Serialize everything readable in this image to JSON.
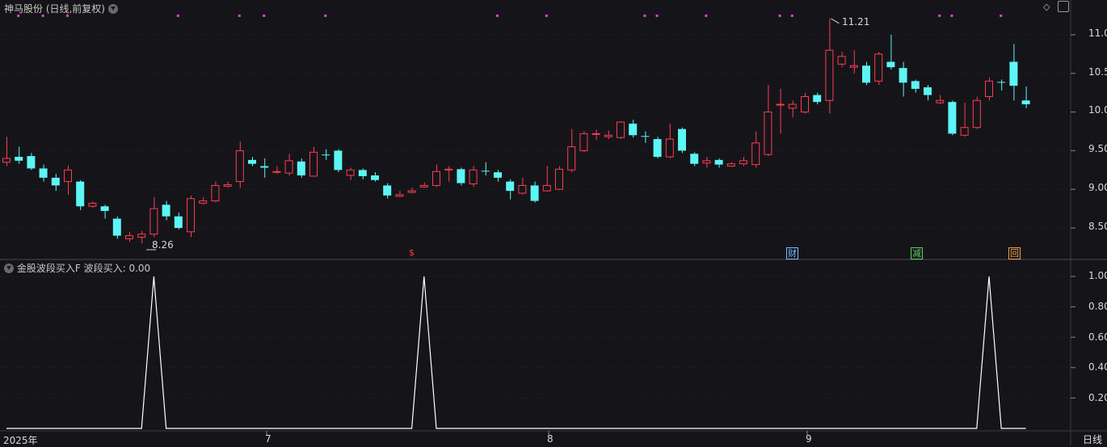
{
  "header": {
    "title": "神马股份 (日线,前复权)"
  },
  "indicator": {
    "name": "金股波段买入F",
    "value_label": "波段买入:",
    "value": "0.00"
  },
  "toolbar": {
    "diamond_icon": "diamond-icon",
    "window_icon": "window-toggle-icon"
  },
  "period_label": "日线",
  "x_axis": {
    "labels": [
      "2025年",
      "7",
      "8",
      "9"
    ]
  },
  "price_axis": [
    "11.00",
    "10.50",
    "10.00",
    "9.50",
    "9.00",
    "8.50"
  ],
  "indicator_axis": [
    "1.00",
    "0.80",
    "0.60",
    "0.40",
    "0.20"
  ],
  "annotations": {
    "high": "11.21",
    "low": "8.26"
  },
  "events": [
    {
      "text": "$",
      "color": "#ff3b3b"
    },
    {
      "text": "财",
      "color": "#7ab8ff"
    },
    {
      "text": "减",
      "color": "#5fd35f"
    },
    {
      "text": "回",
      "color": "#f0a050"
    }
  ],
  "colors": {
    "up": "#ff3b52",
    "down": "#5df5f5",
    "dot": "#e040e0",
    "line": "#ffffff"
  },
  "chart_data": {
    "type": "candlestick",
    "price_range": [
      8.15,
      11.2
    ],
    "indicator_range": [
      0,
      1.05
    ],
    "candles": [
      [
        9.35,
        9.4,
        9.68,
        9.3
      ],
      [
        9.42,
        9.37,
        9.55,
        9.33
      ],
      [
        9.43,
        9.27,
        9.47,
        9.25
      ],
      [
        9.27,
        9.15,
        9.32,
        9.1
      ],
      [
        9.15,
        9.05,
        9.2,
        8.98
      ],
      [
        9.1,
        9.25,
        9.31,
        8.93
      ],
      [
        9.1,
        8.78,
        9.12,
        8.73
      ],
      [
        8.78,
        8.82,
        8.84,
        8.76
      ],
      [
        8.78,
        8.72,
        8.8,
        8.62
      ],
      [
        8.62,
        8.4,
        8.65,
        8.36
      ],
      [
        8.36,
        8.4,
        8.45,
        8.32
      ],
      [
        8.38,
        8.42,
        8.46,
        8.3
      ],
      [
        8.42,
        8.75,
        8.9,
        8.38
      ],
      [
        8.8,
        8.65,
        8.85,
        8.6
      ],
      [
        8.65,
        8.5,
        8.7,
        8.48
      ],
      [
        8.45,
        8.88,
        8.92,
        8.38
      ],
      [
        8.82,
        8.85,
        8.9,
        8.8
      ],
      [
        8.85,
        9.05,
        9.1,
        8.83
      ],
      [
        9.04,
        9.06,
        9.1,
        9.02
      ],
      [
        9.1,
        9.5,
        9.62,
        9.02
      ],
      [
        9.38,
        9.33,
        9.42,
        9.3
      ],
      [
        9.3,
        9.28,
        9.4,
        9.15
      ],
      [
        9.23,
        9.23,
        9.3,
        9.2
      ],
      [
        9.21,
        9.37,
        9.46,
        9.18
      ],
      [
        9.36,
        9.18,
        9.4,
        9.15
      ],
      [
        9.17,
        9.48,
        9.55,
        9.17
      ],
      [
        9.45,
        9.44,
        9.52,
        9.38
      ],
      [
        9.5,
        9.25,
        9.52,
        9.22
      ],
      [
        9.18,
        9.25,
        9.28,
        9.12
      ],
      [
        9.25,
        9.17,
        9.27,
        9.13
      ],
      [
        9.18,
        9.12,
        9.22,
        9.1
      ],
      [
        9.05,
        8.92,
        9.08,
        8.88
      ],
      [
        8.91,
        8.93,
        8.98,
        8.9
      ],
      [
        8.96,
        8.98,
        9.02,
        8.95
      ],
      [
        9.03,
        9.05,
        9.09,
        9.02
      ],
      [
        9.05,
        9.23,
        9.32,
        9.03
      ],
      [
        9.25,
        9.26,
        9.3,
        9.1
      ],
      [
        9.26,
        9.08,
        9.28,
        9.05
      ],
      [
        9.07,
        9.25,
        9.3,
        9.03
      ],
      [
        9.24,
        9.23,
        9.35,
        9.18
      ],
      [
        9.22,
        9.15,
        9.25,
        9.1
      ],
      [
        9.1,
        8.98,
        9.13,
        8.87
      ],
      [
        8.95,
        9.05,
        9.15,
        8.93
      ],
      [
        9.05,
        8.85,
        9.1,
        8.83
      ],
      [
        8.98,
        9.05,
        9.3,
        8.97
      ],
      [
        9.0,
        9.26,
        9.3,
        8.99
      ],
      [
        9.25,
        9.55,
        9.78,
        9.22
      ],
      [
        9.5,
        9.72,
        9.75,
        9.48
      ],
      [
        9.71,
        9.72,
        9.77,
        9.64
      ],
      [
        9.68,
        9.7,
        9.76,
        9.65
      ],
      [
        9.67,
        9.87,
        9.88,
        9.65
      ],
      [
        9.85,
        9.7,
        9.9,
        9.67
      ],
      [
        9.69,
        9.68,
        9.75,
        9.6
      ],
      [
        9.65,
        9.42,
        9.68,
        9.4
      ],
      [
        9.42,
        9.65,
        9.85,
        9.4
      ],
      [
        9.78,
        9.5,
        9.8,
        9.47
      ],
      [
        9.46,
        9.33,
        9.48,
        9.3
      ],
      [
        9.34,
        9.37,
        9.42,
        9.28
      ],
      [
        9.38,
        9.32,
        9.4,
        9.28
      ],
      [
        9.3,
        9.33,
        9.35,
        9.29
      ],
      [
        9.33,
        9.37,
        9.42,
        9.3
      ],
      [
        9.32,
        9.6,
        9.75,
        9.28
      ],
      [
        9.45,
        10.0,
        10.35,
        9.43
      ],
      [
        10.1,
        10.1,
        10.3,
        9.72
      ],
      [
        10.05,
        10.1,
        10.15,
        9.93
      ],
      [
        10.0,
        10.2,
        10.25,
        9.98
      ],
      [
        10.22,
        10.13,
        10.25,
        10.1
      ],
      [
        10.15,
        10.8,
        11.21,
        9.98
      ],
      [
        10.62,
        10.72,
        10.78,
        10.58
      ],
      [
        10.58,
        10.6,
        10.8,
        10.5
      ],
      [
        10.6,
        10.38,
        10.65,
        10.35
      ],
      [
        10.4,
        10.75,
        10.78,
        10.35
      ],
      [
        10.65,
        10.58,
        11.0,
        10.55
      ],
      [
        10.57,
        10.38,
        10.65,
        10.2
      ],
      [
        10.4,
        10.3,
        10.42,
        10.25
      ],
      [
        10.32,
        10.22,
        10.35,
        10.15
      ],
      [
        10.12,
        10.15,
        10.22,
        10.1
      ],
      [
        10.13,
        9.72,
        10.15,
        9.7
      ],
      [
        9.7,
        9.8,
        10.12,
        9.68
      ],
      [
        9.8,
        10.15,
        10.2,
        9.78
      ],
      [
        10.2,
        10.4,
        10.45,
        10.15
      ],
      [
        10.39,
        10.38,
        10.42,
        10.28
      ],
      [
        10.65,
        10.34,
        10.88,
        10.15
      ],
      [
        10.15,
        10.1,
        10.33,
        10.05
      ]
    ],
    "marker_dots": [
      1,
      3,
      5,
      14,
      19,
      21,
      26,
      40,
      44,
      52,
      53,
      57,
      63,
      64,
      76,
      77,
      81
    ],
    "indicator_series": {
      "name": "波段买入",
      "spikes": [
        12,
        34,
        80
      ],
      "baseline": 0
    }
  }
}
